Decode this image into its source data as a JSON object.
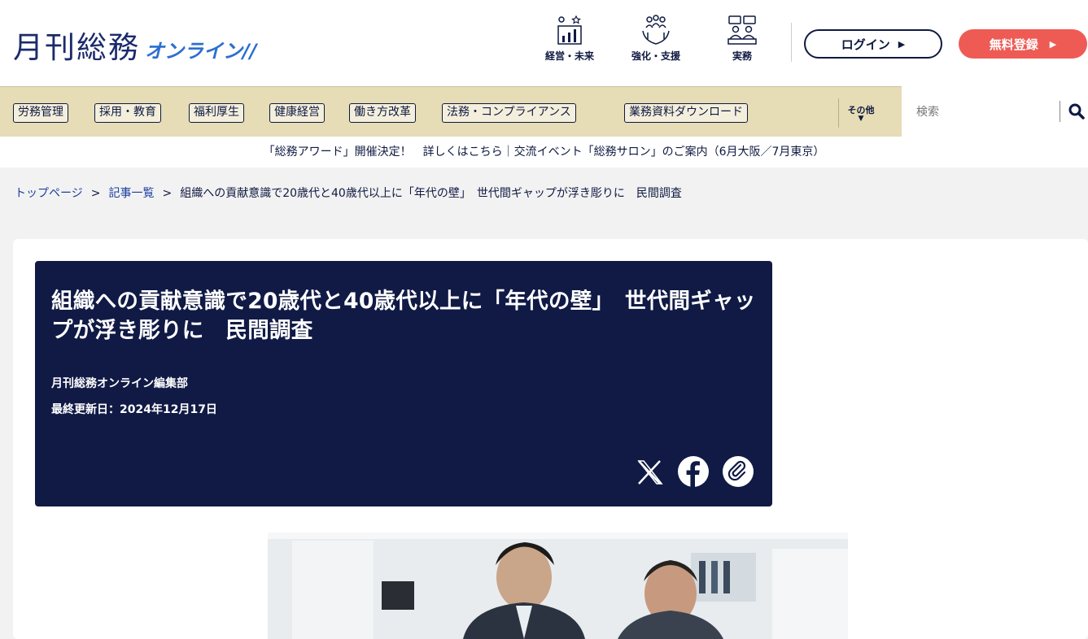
{
  "header": {
    "logo_main": "月刊総務",
    "logo_sub": "オンライン//",
    "categories": [
      {
        "label": "経営・未来",
        "icon": "growth-chart-icon"
      },
      {
        "label": "強化・支援",
        "icon": "team-support-icon"
      },
      {
        "label": "実務",
        "icon": "meeting-icon"
      }
    ],
    "login_label": "ログイン",
    "register_label": "無料登録"
  },
  "nav": {
    "items": [
      "労務管理",
      "採用・教育",
      "福利厚生",
      "健康経営",
      "働き方改革",
      "法務・コンプライアンス",
      "業務資料ダウンロード"
    ],
    "other_label": "その他",
    "search_placeholder": "検索"
  },
  "announcement": {
    "part1": "「総務アワード」開催決定！　詳しくはこちら",
    "separator": "｜",
    "part2": "交流イベント「総務サロン」のご案内（6月大阪／7月東京）"
  },
  "breadcrumb": {
    "home": "トップページ",
    "list": "記事一覧",
    "current": "組織への貢献意識で20歳代と40歳代以上に「年代の壁」　世代間ギャップが浮き彫りに　民間調査",
    "separator": ">"
  },
  "article": {
    "title": "組織への貢献意識で20歳代と40歳代以上に「年代の壁」　世代間ギャップが浮き彫りに　民間調査",
    "author": "月刊総務オンライン編集部",
    "date": "最終更新日：2024年12月17日",
    "share_icons": [
      "x-icon",
      "facebook-icon",
      "copy-link-icon"
    ]
  },
  "colors": {
    "navy": "#101a45",
    "nav_bg": "#e6dcb5",
    "register": "#ee5b55",
    "logo_blue": "#2b6fd1"
  }
}
